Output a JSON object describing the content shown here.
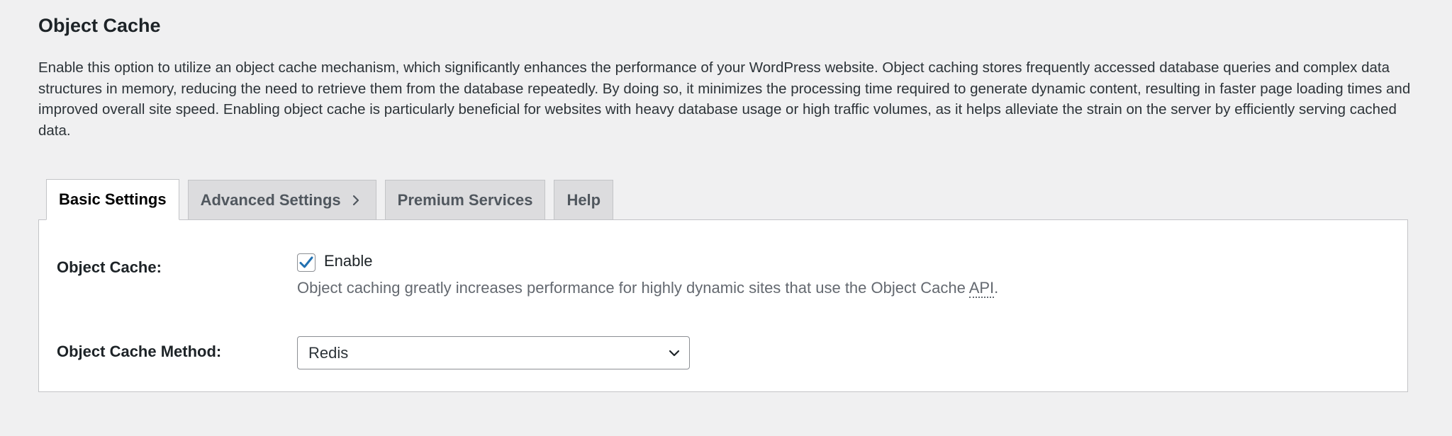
{
  "section": {
    "title": "Object Cache",
    "description": "Enable this option to utilize an object cache mechanism, which significantly enhances the performance of your WordPress website. Object caching stores frequently accessed database queries and complex data structures in memory, reducing the need to retrieve them from the database repeatedly. By doing so, it minimizes the processing time required to generate dynamic content, resulting in faster page loading times and improved overall site speed. Enabling object cache is particularly beneficial for websites with heavy database usage or high traffic volumes, as it helps alleviate the strain on the server by efficiently serving cached data."
  },
  "tabs": [
    {
      "label": "Basic Settings",
      "active": true
    },
    {
      "label": "Advanced Settings",
      "active": false,
      "icon": "chevron-right-icon"
    },
    {
      "label": "Premium Services",
      "active": false
    },
    {
      "label": "Help",
      "active": false
    }
  ],
  "fields": {
    "object_cache": {
      "label": "Object Cache:",
      "checkbox_label": "Enable",
      "checked": true,
      "description_before": "Object caching greatly increases performance for highly dynamic sites that use the Object Cache ",
      "description_abbr": "API",
      "description_after": "."
    },
    "method": {
      "label": "Object Cache Method:",
      "selected": "Redis",
      "icon": "chevron-down-icon"
    }
  },
  "colors": {
    "background": "#f0f0f1",
    "panel": "#ffffff",
    "tab_inactive": "#dcdcde",
    "checkbox_accent": "#2271b1",
    "border": "#c3c4c7"
  }
}
